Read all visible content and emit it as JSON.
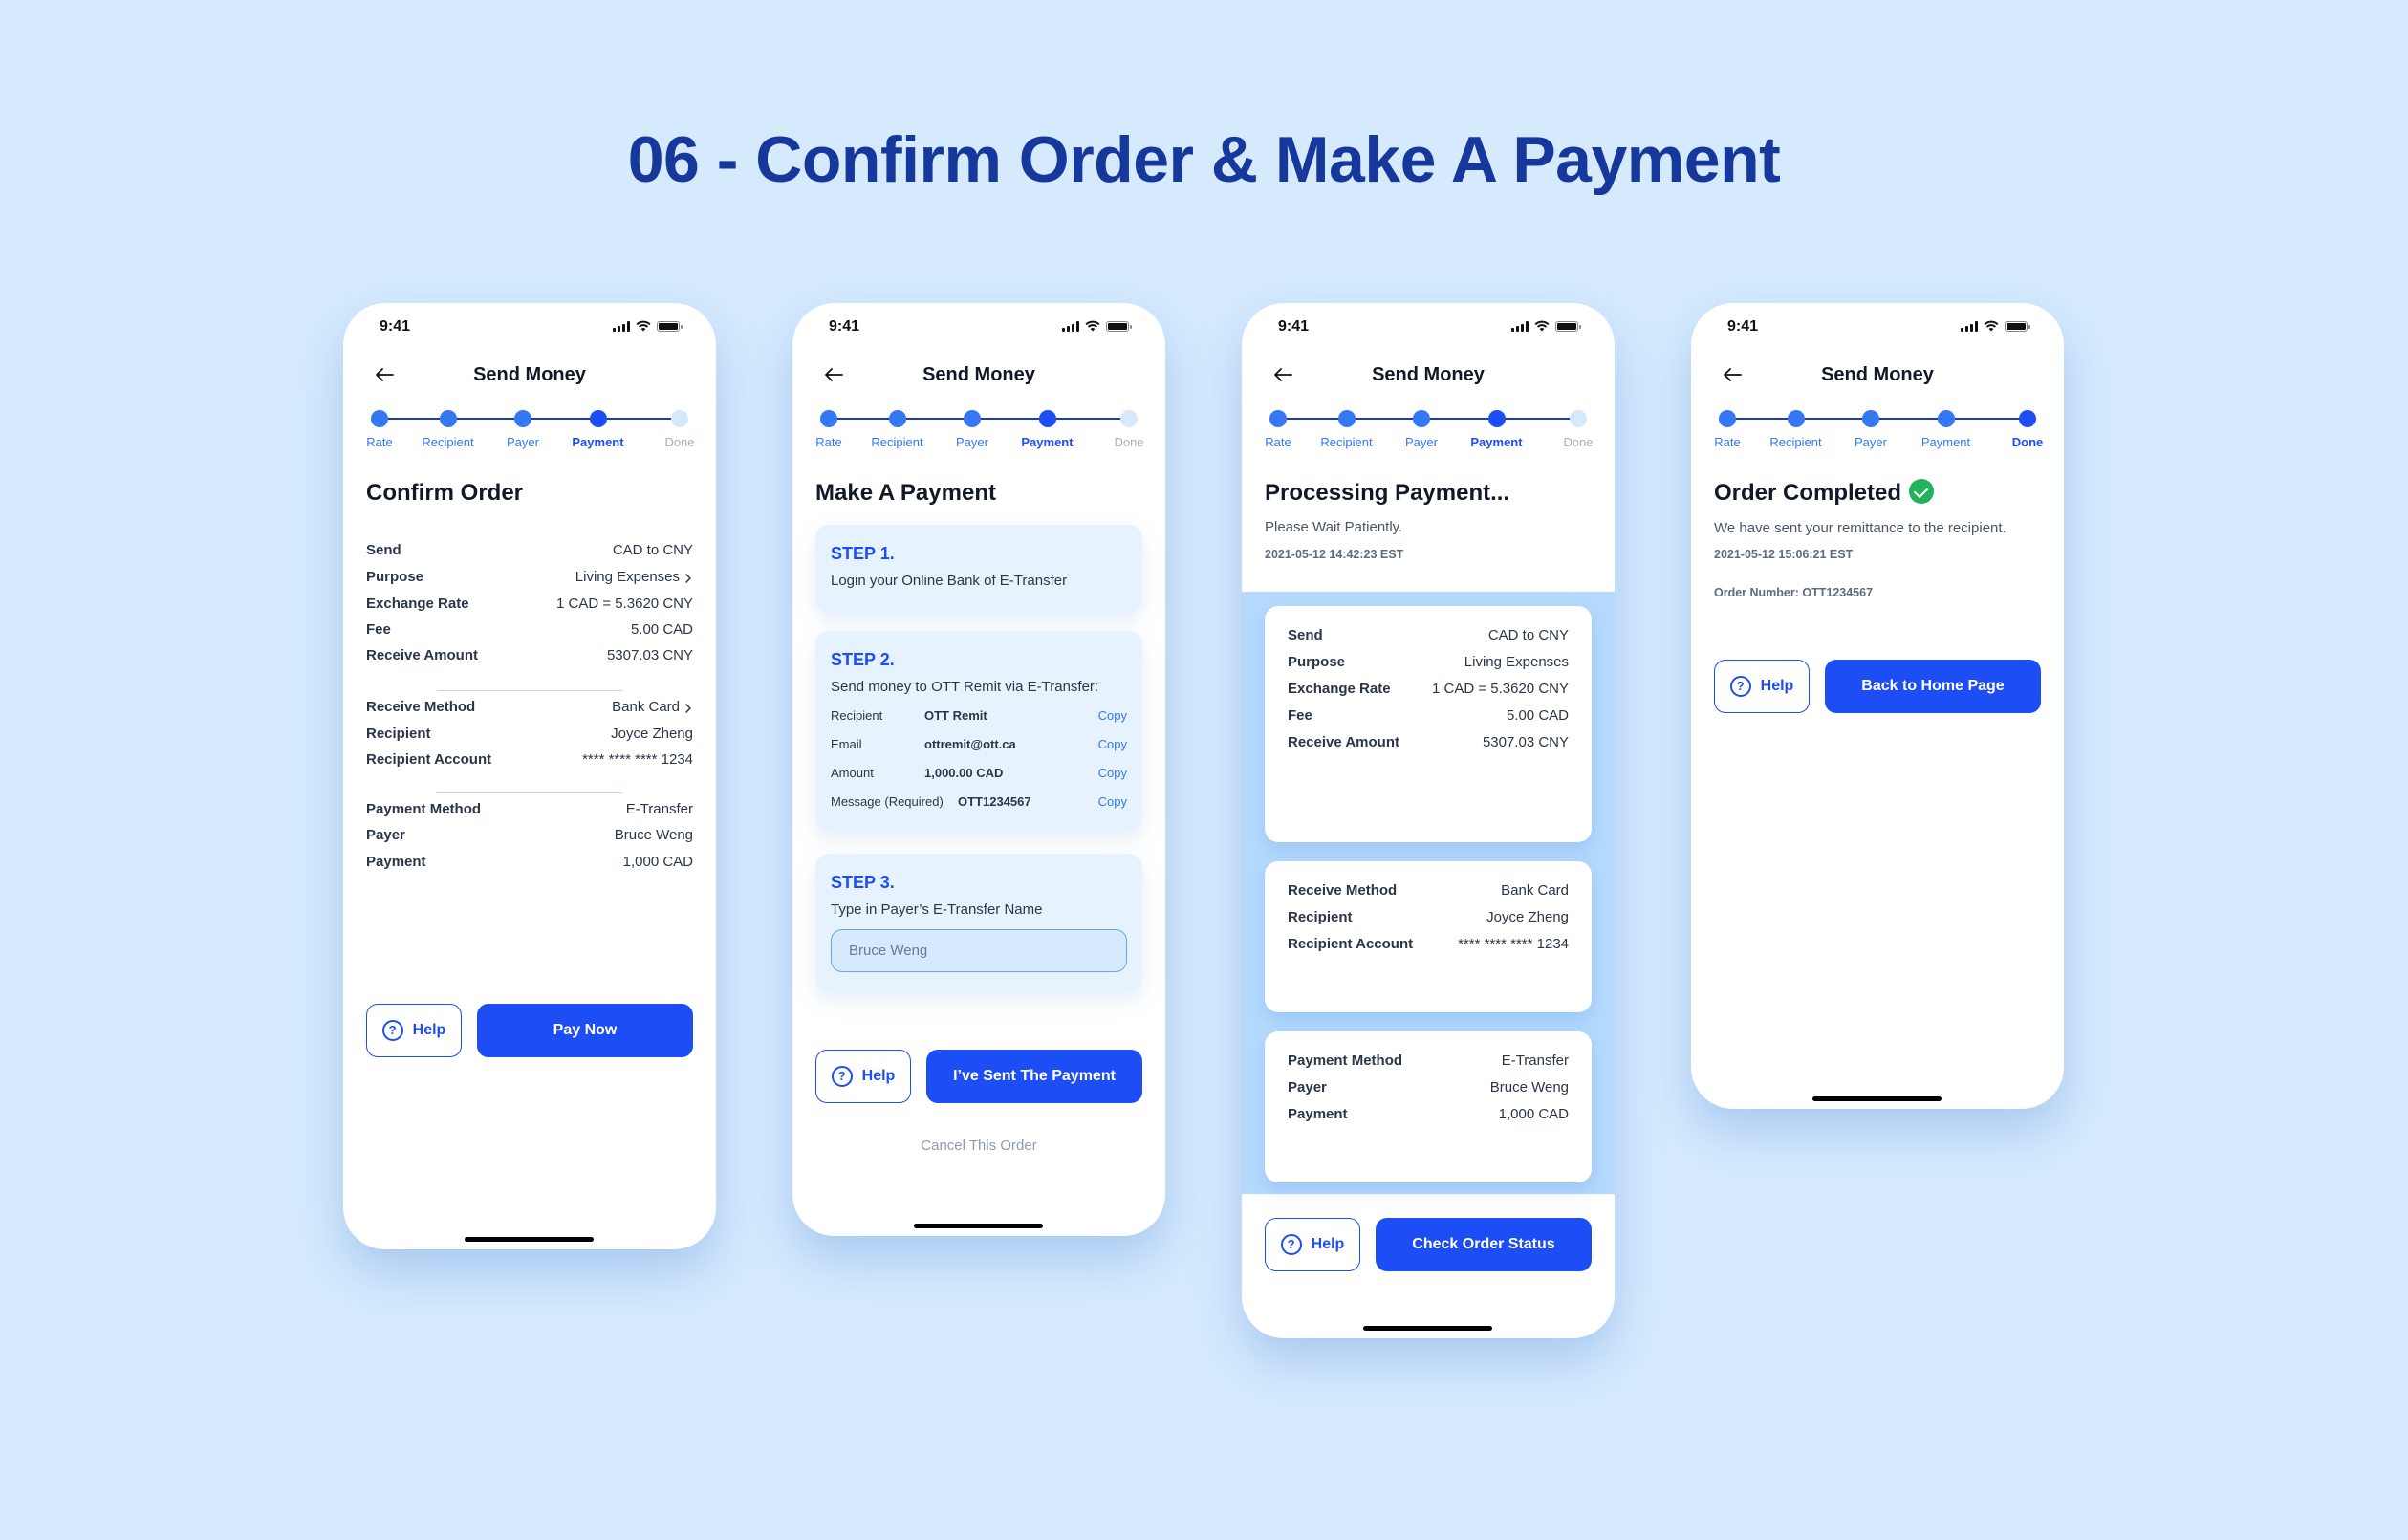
{
  "page_title": "06 - Confirm Order & Make A Payment",
  "colors": {
    "background": "#d5eafd",
    "title": "#16379c",
    "primary": "#1c4df5",
    "step_done": "#3478f6",
    "success": "#22b35a"
  },
  "common": {
    "time": "9:41",
    "nav_title": "Send Money",
    "help_label": "Help",
    "steps": [
      "Rate",
      "Recipient",
      "Payer",
      "Payment",
      "Done"
    ]
  },
  "confirm_order": {
    "heading": "Confirm Order",
    "current_step": "Payment",
    "groups": [
      [
        {
          "label": "Send",
          "value": "CAD to CNY"
        },
        {
          "label": "Purpose",
          "value": "Living Expenses",
          "chevron": true
        },
        {
          "label": "Exchange Rate",
          "value": "1 CAD = 5.3620 CNY"
        },
        {
          "label": "Fee",
          "value": "5.00 CAD"
        },
        {
          "label": "Receive Amount",
          "value": "5307.03 CNY"
        }
      ],
      [
        {
          "label": "Receive Method",
          "value": "Bank Card",
          "chevron": true
        },
        {
          "label": "Recipient",
          "value": "Joyce Zheng"
        },
        {
          "label": "Recipient Account",
          "value": "**** **** **** 1234"
        }
      ],
      [
        {
          "label": "Payment Method",
          "value": "E-Transfer"
        },
        {
          "label": "Payer",
          "value": "Bruce Weng"
        },
        {
          "label": "Payment",
          "value": "1,000 CAD"
        }
      ]
    ],
    "primary_button": "Pay Now"
  },
  "make_payment": {
    "heading": "Make A Payment",
    "current_step": "Payment",
    "step1": {
      "title": "STEP 1.",
      "desc": "Login your Online Bank of E-Transfer"
    },
    "step2": {
      "title": "STEP 2.",
      "desc": "Send money to OTT Remit via E-Transfer:",
      "rows": [
        {
          "label": "Recipient",
          "value": "OTT Remit",
          "action": "Copy"
        },
        {
          "label": "Email",
          "value": "ottremit@ott.ca",
          "action": "Copy"
        },
        {
          "label": "Amount",
          "value": "1,000.00 CAD",
          "action": "Copy"
        },
        {
          "label": "Message (Required)",
          "value": "OTT1234567",
          "action": "Copy"
        }
      ]
    },
    "step3": {
      "title": "STEP 3.",
      "desc": "Type in Payer’s E-Transfer Name",
      "input_value": "Bruce Weng"
    },
    "primary_button": "I’ve Sent The Payment",
    "cancel_link": "Cancel This Order"
  },
  "processing": {
    "heading": "Processing Payment...",
    "subtitle": "Please Wait Patiently.",
    "timestamp": "2021-05-12 14:42:23 EST",
    "current_step": "Payment",
    "cards": [
      [
        {
          "label": "Send",
          "value": "CAD to CNY"
        },
        {
          "label": "Purpose",
          "value": "Living Expenses"
        },
        {
          "label": "Exchange Rate",
          "value": "1 CAD = 5.3620 CNY"
        },
        {
          "label": "Fee",
          "value": "5.00 CAD"
        },
        {
          "label": "Receive Amount",
          "value": "5307.03 CNY"
        }
      ],
      [
        {
          "label": "Receive Method",
          "value": "Bank Card"
        },
        {
          "label": "Recipient",
          "value": "Joyce Zheng"
        },
        {
          "label": "Recipient Account",
          "value": "**** **** **** 1234"
        }
      ],
      [
        {
          "label": "Payment Method",
          "value": "E-Transfer"
        },
        {
          "label": "Payer",
          "value": "Bruce Weng"
        },
        {
          "label": "Payment",
          "value": "1,000 CAD"
        }
      ]
    ],
    "primary_button": "Check Order Status"
  },
  "completed": {
    "heading": "Order Completed",
    "subtitle": "We have sent your remittance to the recipient.",
    "timestamp": "2021-05-12 15:06:21 EST",
    "order_number": "Order Number: OTT1234567",
    "current_step": "Done",
    "primary_button": "Back to Home Page"
  }
}
